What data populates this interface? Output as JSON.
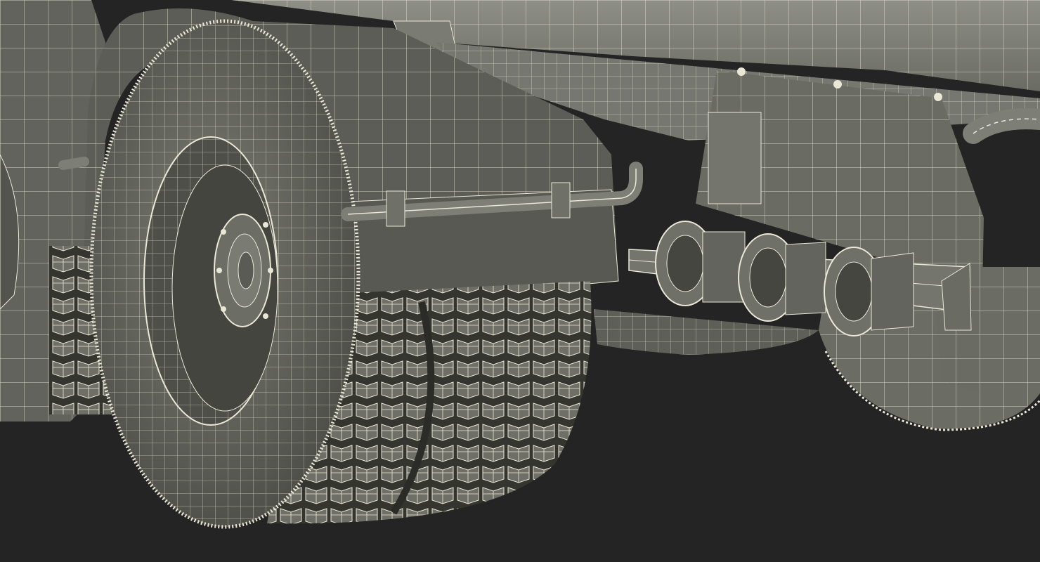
{
  "scene": {
    "subject": "truck-tanker-rear-wheels-wireframe",
    "render_style": "wireframe-over-shaded",
    "colors": {
      "background": "#242424",
      "surface": "#6e6f66",
      "surface_light": "#8a8b82",
      "surface_dark": "#4a4b45",
      "wire": "#e9e7d6",
      "tire": "#5d5e57",
      "tread_shadow": "#34352f"
    }
  }
}
